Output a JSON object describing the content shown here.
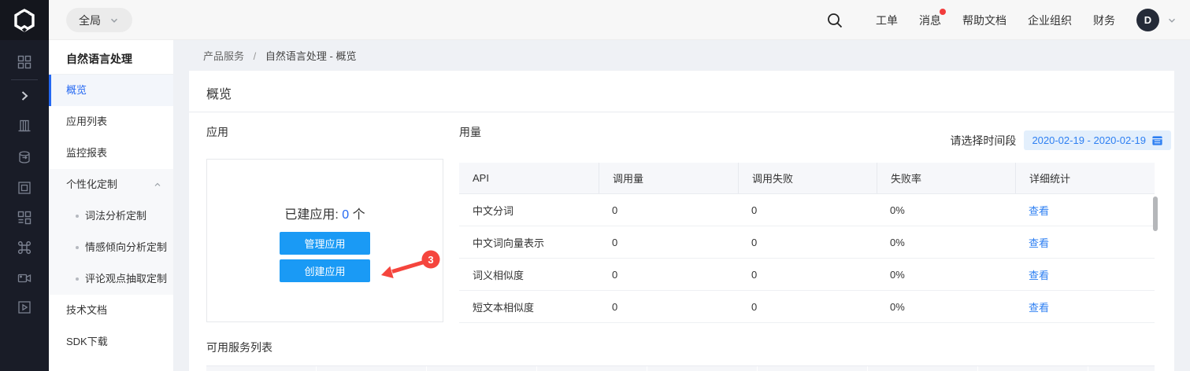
{
  "topbar": {
    "scope": "全局",
    "nav_items": [
      "工单",
      "消息",
      "帮助文档",
      "企业组织",
      "财务"
    ],
    "avatar": "D"
  },
  "icons": {
    "logo": "hexagon-cube",
    "search": "magnifier",
    "scope_caret": "chevron-down",
    "avatar_caret": "chevron-down",
    "group_caret": "chevron-up",
    "calendar": "calendar",
    "rail": [
      "grid",
      "chevron-right",
      "building",
      "database-sync",
      "frame",
      "grid-alt",
      "command",
      "camera",
      "play-square"
    ]
  },
  "sidebar": {
    "title": "自然语言处理",
    "items": [
      {
        "label": "概览",
        "active": true
      },
      {
        "label": "应用列表"
      },
      {
        "label": "监控报表"
      },
      {
        "label": "个性化定制",
        "group": true,
        "children": [
          "词法分析定制",
          "情感倾向分析定制",
          "评论观点抽取定制"
        ]
      },
      {
        "label": "技术文档"
      },
      {
        "label": "SDK下载"
      }
    ]
  },
  "breadcrumb": {
    "section": "产品服务",
    "separator": "/",
    "current": "自然语言处理 - 概览"
  },
  "main": {
    "page_title": "概览",
    "apps": {
      "title": "应用",
      "created_prefix": "已建应用:",
      "created_count": "0",
      "created_unit": "个",
      "manage_button": "管理应用",
      "create_button": "创建应用",
      "annotation_badge": "3"
    },
    "usage": {
      "title": "用量",
      "picker_label": "请选择时间段",
      "date_range": "2020-02-19 - 2020-02-19",
      "table": {
        "headers": [
          "API",
          "调用量",
          "调用失败",
          "失败率",
          "详细统计"
        ],
        "rows": [
          {
            "api": "中文分词",
            "calls": "0",
            "fails": "0",
            "rate": "0%",
            "action": "查看"
          },
          {
            "api": "中文词向量表示",
            "calls": "0",
            "fails": "0",
            "rate": "0%",
            "action": "查看"
          },
          {
            "api": "词义相似度",
            "calls": "0",
            "fails": "0",
            "rate": "0%",
            "action": "查看"
          },
          {
            "api": "短文本相似度",
            "calls": "0",
            "fails": "0",
            "rate": "0%",
            "action": "查看"
          }
        ]
      }
    },
    "services": {
      "title": "可用服务列表"
    }
  },
  "colors": {
    "accent_blue": "#2468f2",
    "link_blue": "#2d7ff2",
    "button_blue": "#1a9af5",
    "annotation_red": "#f5453d",
    "rail_dark": "#191c27",
    "topbar_gray": "#f7f7f7"
  }
}
